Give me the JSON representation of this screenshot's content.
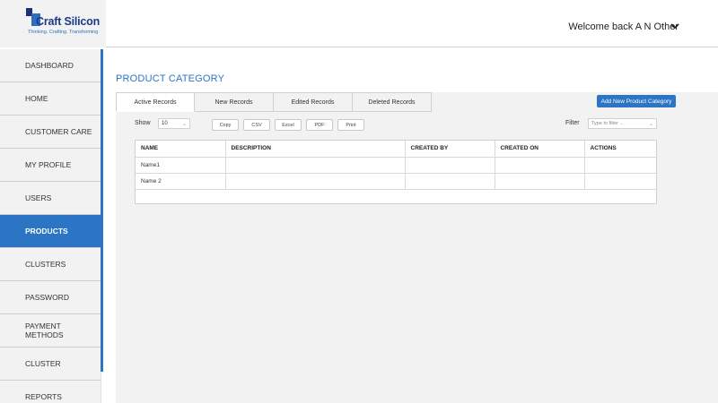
{
  "brand": {
    "name": "Craft Silicon",
    "tagline": "Thinking. Crafting. Transforming",
    "colors": {
      "primary": "#2b75c4",
      "dark": "#1b2f7a"
    }
  },
  "header": {
    "welcome": "Welcome back A N Other",
    "menu_icon": "chevron-down-icon"
  },
  "sidebar": {
    "items": [
      {
        "label": "DASHBOARD"
      },
      {
        "label": "HOME"
      },
      {
        "label": "CUSTOMER CARE"
      },
      {
        "label": "MY PROFILE"
      },
      {
        "label": "USERS"
      },
      {
        "label": "PRODUCTS"
      },
      {
        "label": "CLUSTERS"
      },
      {
        "label": "PASSWORD"
      },
      {
        "label": "PAYMENT METHODS"
      },
      {
        "label": "CLUSTER"
      },
      {
        "label": "REPORTS"
      }
    ],
    "active": "PRODUCTS"
  },
  "main": {
    "title": "PRODUCT CATEGORY",
    "tabs": [
      {
        "label": "Active Records"
      },
      {
        "label": "New Records"
      },
      {
        "label": "Edited Records"
      },
      {
        "label": "Deleted Records"
      }
    ],
    "add_button": "Add New Product Category",
    "show_label": "Show",
    "show_value": "10",
    "export_buttons": [
      {
        "label": "Copy"
      },
      {
        "label": "CSV"
      },
      {
        "label": "Excel"
      },
      {
        "label": "PDF"
      },
      {
        "label": "Print"
      }
    ],
    "filter_label": "Filter",
    "filter_placeholder": "Type to filter ...",
    "table": {
      "headers": [
        "NAME",
        "DESCRIPTION",
        "CREATED BY",
        "CREATED ON",
        "ACTIONS"
      ],
      "rows": [
        [
          "Name1",
          "",
          "",
          "",
          ""
        ],
        [
          "Name 2",
          "",
          "",
          "",
          ""
        ]
      ]
    }
  }
}
